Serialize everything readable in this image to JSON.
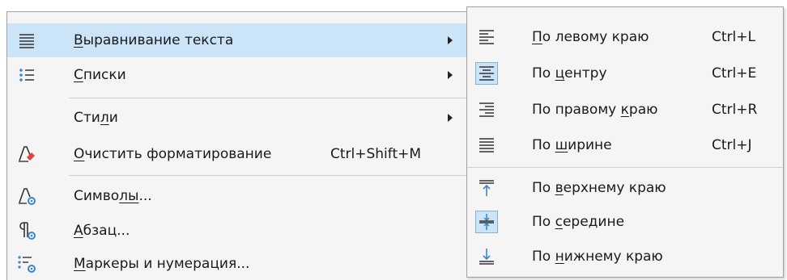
{
  "main_menu": {
    "items": [
      {
        "pre": "",
        "key": "В",
        "post": "ыравнивание текста",
        "shortcut": "",
        "icon": "align-paragraph-icon",
        "submenu": true,
        "highlighted": true
      },
      {
        "pre": "",
        "key": "С",
        "post": "писки",
        "shortcut": "",
        "icon": "list-icon",
        "submenu": true
      },
      {
        "pre": "Сти",
        "key": "л",
        "post": "и",
        "shortcut": "",
        "icon": "",
        "submenu": true
      },
      {
        "pre": "",
        "key": "О",
        "post": "чистить форматирование",
        "shortcut": "Ctrl+Shift+M",
        "icon": "clear-formatting-icon",
        "submenu": false
      },
      {
        "pre": "Симво",
        "key": "лы",
        "post": "...",
        "shortcut": "",
        "icon": "character-icon",
        "submenu": false
      },
      {
        "pre": "",
        "key": "А",
        "post": "бзац...",
        "shortcut": "",
        "icon": "paragraph-icon",
        "submenu": false
      },
      {
        "pre": "",
        "key": "М",
        "post": "аркеры и нумерация...",
        "shortcut": "",
        "icon": "bullets-numbering-icon",
        "submenu": false
      }
    ]
  },
  "sub_menu": {
    "items": [
      {
        "pre": "",
        "key": "П",
        "post": "о левому краю",
        "shortcut": "Ctrl+L",
        "icon": "align-left-icon"
      },
      {
        "pre": "По ",
        "key": "ц",
        "post": "ентру",
        "shortcut": "Ctrl+E",
        "icon": "align-center-icon",
        "checked": true
      },
      {
        "pre": "По правому ",
        "key": "к",
        "post": "раю",
        "shortcut": "Ctrl+R",
        "icon": "align-right-icon"
      },
      {
        "pre": "По ",
        "key": "ш",
        "post": "ирине",
        "shortcut": "Ctrl+J",
        "icon": "align-justify-icon"
      },
      {
        "pre": "По ",
        "key": "в",
        "post": "ерхнему краю",
        "shortcut": "",
        "icon": "align-top-icon"
      },
      {
        "pre": "По ",
        "key": "с",
        "post": "ередине",
        "shortcut": "",
        "icon": "align-middle-icon",
        "checked": true
      },
      {
        "pre": "По ",
        "key": "н",
        "post": "ижнему краю",
        "shortcut": "",
        "icon": "align-bottom-icon"
      }
    ]
  },
  "colors": {
    "highlight": "#cce4f7",
    "menu_bg": "#f5f5f5",
    "icon_blue": "#3a86c8",
    "eraser_red": "#e0443c"
  }
}
